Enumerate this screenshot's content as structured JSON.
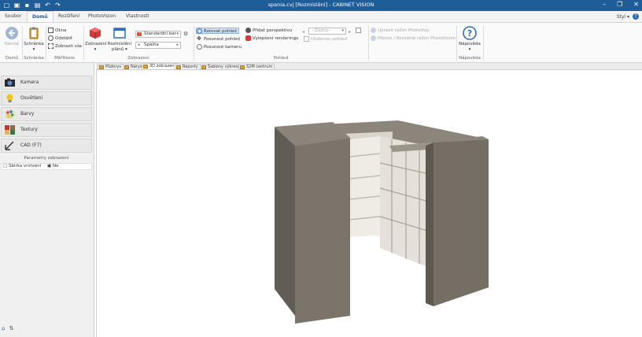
{
  "titlebar": {
    "title": "spania.cvj [Rozmístění] - CABINET VISION"
  },
  "tabs": [
    {
      "label": "Soubor",
      "active": false
    },
    {
      "label": "Domů",
      "active": true
    },
    {
      "label": "Rozšíření",
      "active": false
    },
    {
      "label": "PhotoVision",
      "active": false
    },
    {
      "label": "Vlastnosti",
      "active": false
    }
  ],
  "style_menu": "Styl",
  "ribbon": {
    "domu": {
      "navrat": "Návrat",
      "group": "Domů"
    },
    "schranka": {
      "label": "Schránka",
      "group": "Schránka"
    },
    "mereni": {
      "okna": "Okna",
      "odstatit": "Odstátit",
      "zobrazit": "Zobrazit vše",
      "group": "Měřítkem"
    },
    "zobrazeni": {
      "zobrazeni_btn": "Zobrazení",
      "rozmisteni_btn": "Rozmístění plánů",
      "combo1": "Standardní bar",
      "combo2": "Spálňa",
      "group": "Zobrazení"
    },
    "pohled": {
      "rotovat": "Rotovat pohled",
      "posunout": "Posunout pohled",
      "kamera": "Posunout kameru",
      "pridat": "Přidat perspektivu",
      "vylepseni": "Vylepšení renderingu",
      "combo": "--Žádný--",
      "ulozit": "Uloženou pohled",
      "group": "Pohled"
    },
    "photovision": {
      "upravit": "Upravit režim PhotoVisy",
      "prenos": "Přenos / Rozsáhlé režim PhotoVision"
    },
    "napoveda": {
      "label": "Nápověda",
      "group": "Nápověda"
    }
  },
  "leftpanel": {
    "nav": [
      {
        "label": "Kamera",
        "icon": "camera-icon"
      },
      {
        "label": "Osvětlení",
        "icon": "lightbulb-icon"
      },
      {
        "label": "Barvy",
        "icon": "palette-icon"
      },
      {
        "label": "Textury",
        "icon": "texture-icon"
      },
      {
        "label": "CAD (F7)",
        "icon": "cad-icon"
      }
    ],
    "panel_title": "Parametry zobrazení",
    "property": {
      "label": "Sbírka vrstvení",
      "value": "Ne"
    }
  },
  "viewtabs": [
    {
      "label": "Půdorys",
      "active": false
    },
    {
      "label": "Nárys",
      "active": false
    },
    {
      "label": "3D zobrazení",
      "active": true
    },
    {
      "label": "Reporty",
      "active": false
    },
    {
      "label": "Šablony výkresů",
      "active": false
    },
    {
      "label": "S2M centrum",
      "active": false
    }
  ],
  "colors": {
    "titlebar": "#1f5d99",
    "cabinet_dark": "#6f6a62",
    "cabinet_inner": "#e7e3dc"
  }
}
